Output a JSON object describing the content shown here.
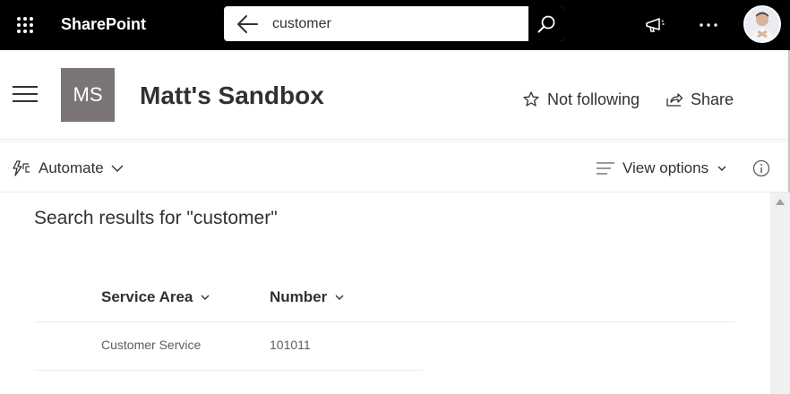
{
  "suite_bar": {
    "brand": "SharePoint",
    "search": {
      "value": "customer",
      "placeholder": ""
    },
    "icons": [
      "waffle-icon",
      "back-arrow-icon",
      "search-icon",
      "megaphone-icon",
      "more-icon"
    ]
  },
  "site": {
    "logo_initials": "MS",
    "title": "Matt's Sandbox",
    "follow_label": "Not following",
    "share_label": "Share"
  },
  "command_bar": {
    "automate_label": "Automate",
    "view_options_label": "View options"
  },
  "results": {
    "heading": "Search results for \"customer\"",
    "columns": [
      {
        "label": "Service Area"
      },
      {
        "label": "Number"
      }
    ],
    "rows": [
      {
        "service_area": "Customer Service",
        "number": "101011"
      }
    ]
  },
  "colors": {
    "suite_bar_bg": "#000000",
    "site_logo_bg": "#7a7574",
    "text_primary": "#323130",
    "text_secondary": "#605e5c"
  }
}
